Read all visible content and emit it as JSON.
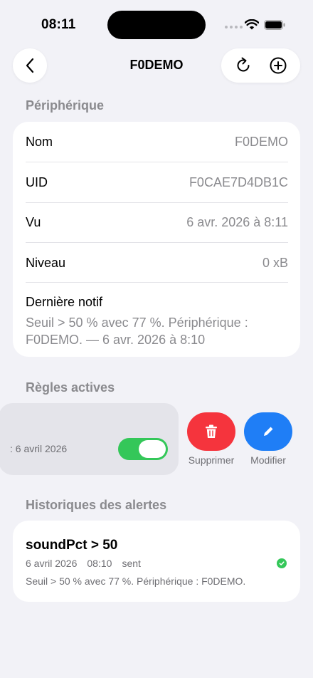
{
  "status_bar": {
    "time": "08:11"
  },
  "nav": {
    "title": "F0DEMO"
  },
  "device_section": {
    "header": "Périphérique",
    "rows": [
      {
        "label": "Nom",
        "value": "F0DEMO"
      },
      {
        "label": "UID",
        "value": "F0CAE7D4DB1C"
      },
      {
        "label": "Vu",
        "value": "6 avr. 2026 à 8:11"
      },
      {
        "label": "Niveau",
        "value": "0 xB"
      }
    ],
    "last_notif": {
      "label": "Dernière notif",
      "text": "Seuil > 50 % avec 77 %. Périphérique : F0DEMO. — 6 avr. 2026 à 8:10"
    }
  },
  "rules_section": {
    "header": "Règles actives",
    "rule": {
      "date_fragment": ": 6 avril 2026",
      "enabled": true
    },
    "delete_label": "Supprimer",
    "edit_label": "Modifier"
  },
  "history_section": {
    "header": "Historiques des alertes",
    "alert": {
      "title": "soundPct > 50",
      "date": "6 avril 2026",
      "time": "08:10",
      "status": "sent",
      "message": "Seuil > 50 % avec 77 %. Périphérique : F0DEMO."
    }
  },
  "colors": {
    "accent_green": "#34c759",
    "delete_red": "#f5343d",
    "edit_blue": "#1f7ef6"
  }
}
